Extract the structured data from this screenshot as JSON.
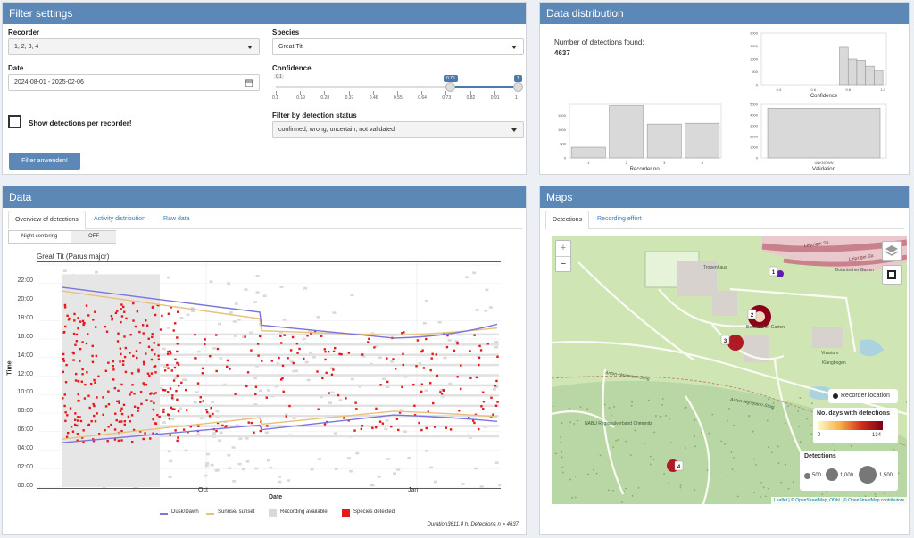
{
  "filter": {
    "title": "Filter settings",
    "recorder_label": "Recorder",
    "recorder_value": "1, 2, 3, 4",
    "date_label": "Date",
    "date_value": "2024-08-01 - 2025-02-06",
    "species_label": "Species",
    "species_value": "Great Tit",
    "confidence_label": "Confidence",
    "confidence_min_label": "0.1",
    "confidence_low_value": "0.75",
    "confidence_high_value": "1",
    "confidence_ticks": [
      "0.1",
      "0.19",
      "0.28",
      "0.37",
      "0.46",
      "0.55",
      "0.64",
      "0.73",
      "0.82",
      "0.91",
      "1"
    ],
    "show_per_recorder_label": "Show detections per recorder!",
    "status_label": "Filter by detection status",
    "status_value": "confirmed, wrong, uncertain, not validated",
    "apply_label": "Filter anwenden!"
  },
  "distribution": {
    "title": "Data distribution",
    "count_label": "Number of detections found:",
    "count_value": "4637",
    "conf_xlabel": "Confidence",
    "rec_xlabel": "Recorder no.",
    "val_xlabel": "Validation"
  },
  "data_panel": {
    "title": "Data",
    "tabs": [
      "Overview of detections",
      "Activity distribution",
      "Raw data"
    ],
    "night_label": "Night centering",
    "night_value": "OFF",
    "plot_title": "Great Tit (Parus major)",
    "ylabel": "Time",
    "xlabel": "Date",
    "yticks": [
      "22:00",
      "20:00",
      "18:00",
      "16:00",
      "14:00",
      "12:00",
      "10:00",
      "08:00",
      "06:00",
      "04:00",
      "02:00",
      "00:00"
    ],
    "xticks": [
      "Oct",
      "Jan"
    ],
    "legend": [
      "Dusk/Dawn",
      "Sunrise/ sunset",
      "Recording available",
      "Species detected"
    ],
    "footer": "Duration3611.4 h, Detections n = 4637"
  },
  "maps": {
    "title": "Maps",
    "tabs": [
      "Detections",
      "Recording effort"
    ],
    "labels": [
      "Leipziger Str.",
      "Leipziger Str.",
      "Tropenhaus",
      "Botanischer Garten",
      "Botanischer Garten",
      "Vivarium",
      "Klangbogen",
      "NABU Regionalverband Chemnitz",
      "Anton-Herrmann-Steig",
      "Anton-Herrmann-Steig"
    ],
    "markers": [
      "1",
      "2",
      "3",
      "4"
    ],
    "legend_location": "Recorder location",
    "legend_days_title": "No. days with detections",
    "legend_days_min": "0",
    "legend_days_max": "134",
    "legend_det_title": "Detections",
    "legend_det_values": [
      "500",
      "1,000",
      "1,500"
    ],
    "attribution": "Leaflet | © OpenStreetMap, ODbL, © OpenStreetMap contributors"
  },
  "chart_data": [
    {
      "type": "bar",
      "title": "",
      "xlabel": "Confidence",
      "categories": [
        "0.75-0.8",
        "0.8-0.85",
        "0.85-0.9",
        "0.9-0.95",
        "0.95-1"
      ],
      "values": [
        1450,
        1000,
        950,
        720,
        550
      ],
      "ylim": [
        0,
        2000
      ]
    },
    {
      "type": "bar",
      "title": "",
      "xlabel": "Recorder no.",
      "categories": [
        "1",
        "2",
        "3",
        "4"
      ],
      "values": [
        380,
        1850,
        1200,
        1230
      ],
      "ylim": [
        0,
        1900
      ]
    },
    {
      "type": "bar",
      "title": "",
      "xlabel": "Validation",
      "categories": [
        "UNKNOWN"
      ],
      "values": [
        4637
      ],
      "ylim": [
        0,
        5000
      ]
    }
  ]
}
